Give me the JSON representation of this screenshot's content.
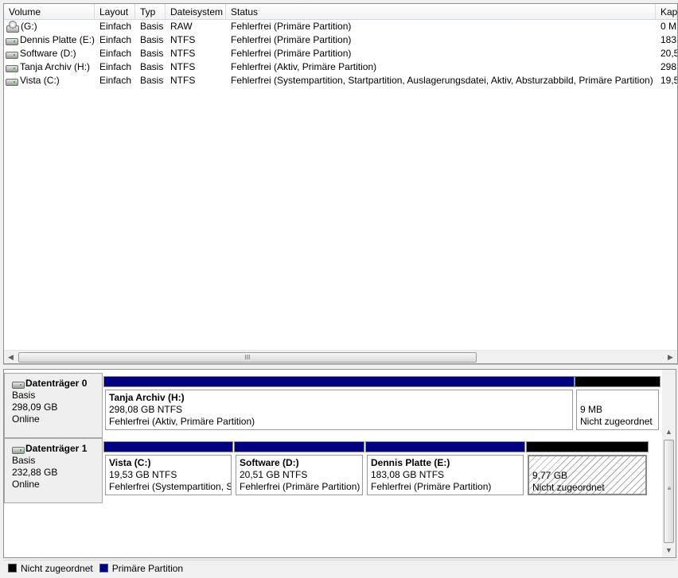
{
  "volume_list": {
    "columns": [
      "Volume",
      "Layout",
      "Typ",
      "Dateisystem",
      "Status",
      "Kap"
    ],
    "rows": [
      {
        "icon": "cd-drive-icon",
        "volume": "(G:)",
        "layout": "Einfach",
        "typ": "Basis",
        "fs": "RAW",
        "status": "Fehlerfrei (Primäre Partition)",
        "kap": "0 M"
      },
      {
        "icon": "hard-drive-icon",
        "volume": "Dennis Platte (E:)",
        "layout": "Einfach",
        "typ": "Basis",
        "fs": "NTFS",
        "status": "Fehlerfrei (Primäre Partition)",
        "kap": "183"
      },
      {
        "icon": "hard-drive-icon",
        "volume": "Software (D:)",
        "layout": "Einfach",
        "typ": "Basis",
        "fs": "NTFS",
        "status": "Fehlerfrei (Primäre Partition)",
        "kap": "20,5"
      },
      {
        "icon": "hard-drive-icon",
        "volume": "Tanja Archiv (H:)",
        "layout": "Einfach",
        "typ": "Basis",
        "fs": "NTFS",
        "status": "Fehlerfrei (Aktiv, Primäre Partition)",
        "kap": "298"
      },
      {
        "icon": "hard-drive-icon",
        "volume": "Vista (C:)",
        "layout": "Einfach",
        "typ": "Basis",
        "fs": "NTFS",
        "status": "Fehlerfrei (Systempartition, Startpartition, Auslagerungsdatei, Aktiv, Absturzabbild, Primäre Partition)",
        "kap": "19,5"
      }
    ],
    "hscroll_grip": "III"
  },
  "disks": [
    {
      "title": "Datenträger 0",
      "type": "Basis",
      "size": "298,09 GB",
      "state": "Online",
      "partitions": [
        {
          "name": "Tanja Archiv  (H:)",
          "size": "298,08 GB NTFS",
          "status": "Fehlerfrei (Aktiv, Primäre Partition)",
          "kind": "primary"
        },
        {
          "name": "",
          "size": "9 MB",
          "status": "Nicht zugeordnet",
          "kind": "unallocated"
        }
      ]
    },
    {
      "title": "Datenträger 1",
      "type": "Basis",
      "size": "232,88 GB",
      "state": "Online",
      "partitions": [
        {
          "name": "Vista  (C:)",
          "size": "19,53 GB NTFS",
          "status": "Fehlerfrei (Systempartition, S",
          "kind": "primary"
        },
        {
          "name": "Software  (D:)",
          "size": "20,51 GB NTFS",
          "status": "Fehlerfrei (Primäre Partition)",
          "kind": "primary"
        },
        {
          "name": "Dennis Platte  (E:)",
          "size": "183,08 GB NTFS",
          "status": "Fehlerfrei (Primäre Partition)",
          "kind": "primary"
        },
        {
          "name": "",
          "size": "9,77 GB",
          "status": "Nicht zugeordnet",
          "kind": "unallocated"
        }
      ]
    }
  ],
  "vscroll_grip": "≡",
  "legend": [
    {
      "label": "Nicht zugeordnet",
      "color": "#000000"
    },
    {
      "label": "Primäre Partition",
      "color": "#000080"
    }
  ]
}
